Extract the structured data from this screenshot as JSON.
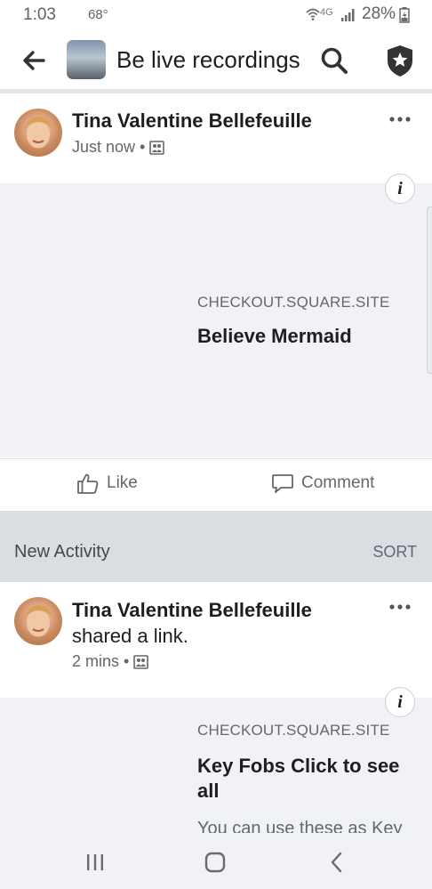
{
  "status_bar": {
    "time": "1:03",
    "temperature": "68°",
    "network": "4G",
    "battery": "28%"
  },
  "header": {
    "title": "Be live recordings",
    "back_icon": "arrow-left-icon",
    "search_icon": "search-icon",
    "badge_icon": "shield-star-icon"
  },
  "posts": [
    {
      "author": "Tina Valentine Bellefeuille",
      "action": "",
      "time": "Just now",
      "separator": "•",
      "audience_icon": "group-audience-icon",
      "link": {
        "domain": "CHECKOUT.SQUARE.SITE",
        "title": "Believe Mermaid",
        "description": ""
      }
    },
    {
      "author": "Tina Valentine Bellefeuille",
      "action": "shared a link.",
      "time": "2 mins",
      "separator": "•",
      "audience_icon": "group-audience-icon",
      "link": {
        "domain": "CHECKOUT.SQUARE.SITE",
        "title": "Key Fobs Click to see all",
        "description": "You can use these as Key"
      }
    }
  ],
  "actions": {
    "like_label": "Like",
    "comment_label": "Comment"
  },
  "activity": {
    "title": "New Activity",
    "sort_label": "SORT"
  },
  "nav": {
    "recents_icon": "recent-apps-icon",
    "home_icon": "home-icon",
    "back_icon": "back-chevron-icon"
  },
  "colors": {
    "text": "#1c1e21",
    "secondary": "#65676b",
    "card_bg": "#f0f2f5",
    "section_bg": "#dadde1"
  }
}
